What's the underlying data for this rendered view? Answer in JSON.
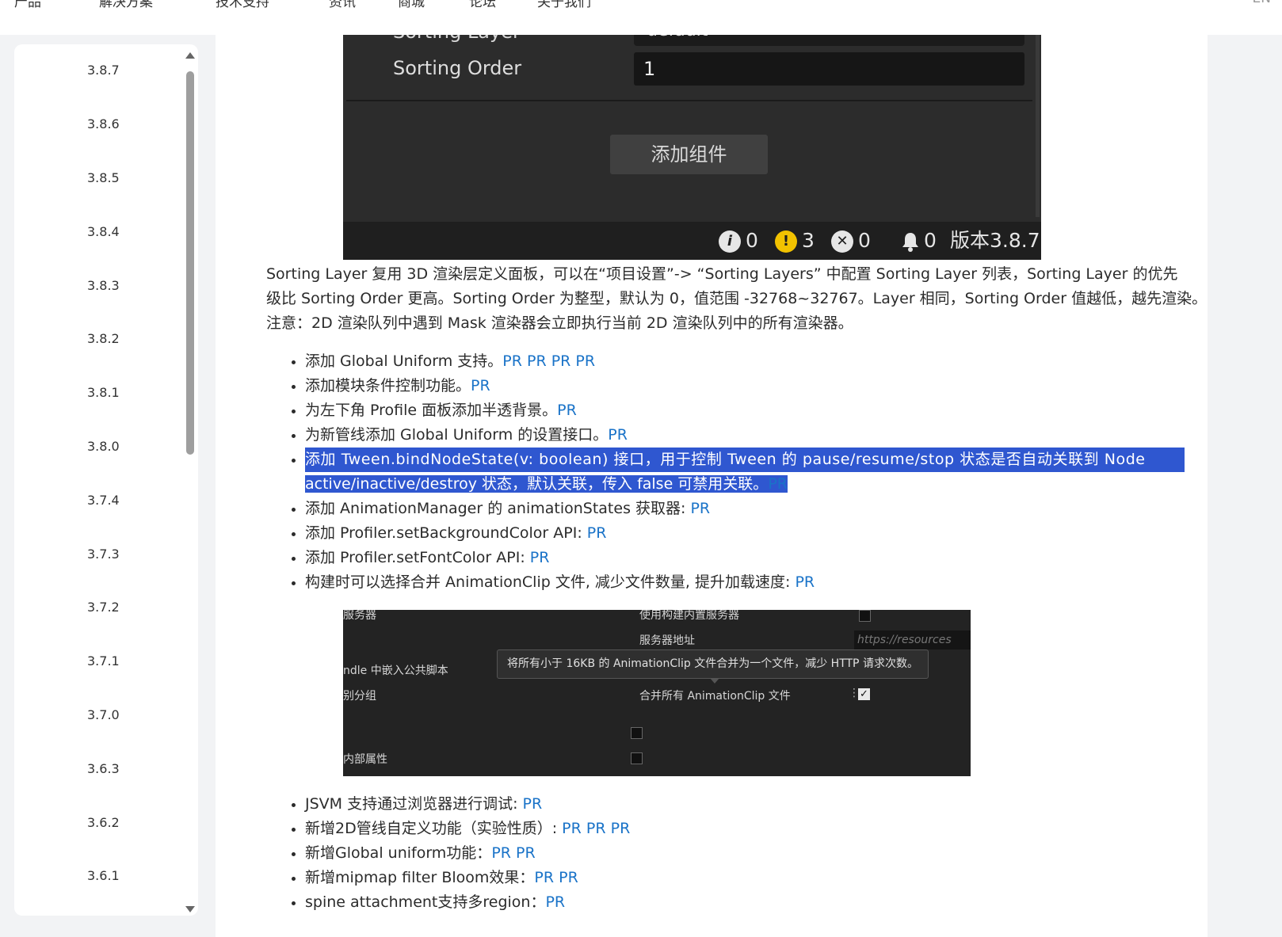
{
  "topnav": {
    "items": [
      "产品",
      "解决方案",
      "技术支持",
      "资讯",
      "商城",
      "论坛",
      "关于我们"
    ],
    "right": "EN"
  },
  "sidebar": {
    "items": [
      "3.8.7",
      "3.8.6",
      "3.8.5",
      "3.8.4",
      "3.8.3",
      "3.8.2",
      "3.8.1",
      "3.8.0",
      "3.7.4",
      "3.7.3",
      "3.7.2",
      "3.7.1",
      "3.7.0",
      "3.6.3",
      "3.6.2",
      "3.6.1"
    ]
  },
  "editor_shot": {
    "sorting_layer_label": "Sorting Layer",
    "sorting_layer_value": "default",
    "sorting_order_label": "Sorting Order",
    "sorting_order_value": "1",
    "add_component_label": "添加组件",
    "status": {
      "info_count": "0",
      "warn_count": "3",
      "error_count": "0",
      "bell_count": "0",
      "version": "版本3.8.7"
    }
  },
  "paragraph": {
    "line1": "Sorting Layer 复用 3D 渲染层定义面板，可以在“项目设置”-> “Sorting Layers” 中配置 Sorting Layer 列表，Sorting Layer 的优先",
    "line2": "级比 Sorting Order 更高。Sorting Order 为整型，默认为 0，值范围 -32768~32767。Layer 相同，Sorting Order 值越低，越先渲染。",
    "line3": "注意：2D 渲染队列中遇到 Mask 渲染器会立即执行当前 2D 渲染队列中的所有渲染器。"
  },
  "changes1": {
    "i0_text": "添加 Global Uniform 支持。",
    "i1_text": "添加模块条件控制功能。",
    "i2_text": "为左下角 Profile 面板添加半透背景。",
    "i3_text": "为新管线添加 Global Uniform 的设置接口。",
    "i4_line1": "添加 Tween.bindNodeState(v: boolean) 接口，用于控制 Tween 的 pause/resume/stop 状态是否自动关联到 Node",
    "i4_line2": "active/inactive/destroy 状态，默认关联，传入 false 可禁用关联。",
    "i5_text": "添加 AnimationManager 的 animationStates 获取器: ",
    "i6_text": "添加 Profiler.setBackgroundColor API: ",
    "i7_text": "添加 Profiler.setFontColor API: ",
    "i8_text": "构建时可以选择合并 AnimationClip 文件, 减少文件数量, 提升加载速度: ",
    "pr": "PR"
  },
  "build_shot": {
    "left_server": "服务器",
    "left_bundle": "ndle 中嵌入公共脚本",
    "left_group": "别分组",
    "left_internal": "内部属性",
    "use_builtin_server": "使用构建内置服务器",
    "server_addr": "服务器地址",
    "server_placeholder": "https://resources",
    "tooltip": "将所有小于 16KB 的 AnimationClip 文件合并为一个文件，减少 HTTP 请求次数。",
    "merge_all": "合并所有 AnimationClip 文件",
    "check": "✓"
  },
  "changes2": {
    "i0_text": "JSVM 支持通过浏览器进行调试: ",
    "i1_text": "新增2D管线自定义功能（实验性质）: ",
    "i2_text": "新增Global uniform功能：",
    "i3_text": "新增mipmap filter Bloom效果：",
    "i4_text": "spine attachment支持多region：",
    "pr": "PR"
  }
}
